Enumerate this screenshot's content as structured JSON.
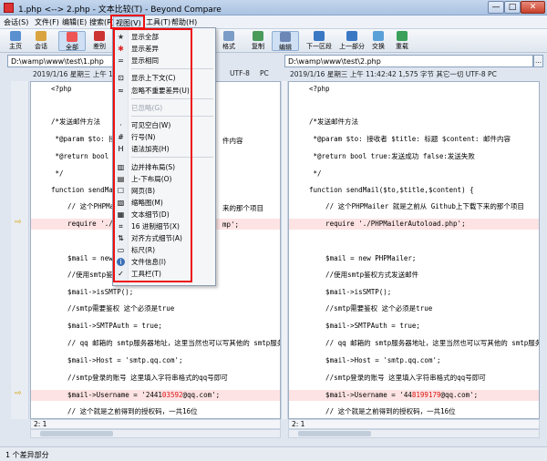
{
  "window": {
    "title": "1.php <--> 2.php - 文本比较(T) - Beyond Compare",
    "controls": [
      "—",
      "□",
      "✕"
    ]
  },
  "menubar": [
    "会话(S)",
    "文件(F)",
    "编辑(E)",
    "搜索(R)",
    "视图(V)",
    "工具(T)",
    "帮助(H)"
  ],
  "toolbar": {
    "left": [
      "主页",
      "会话",
      "全部",
      "差别"
    ],
    "right": [
      "复制",
      "编辑",
      "下一区段",
      "上一部分",
      "交换",
      "重载"
    ],
    "partial": "格式"
  },
  "paths": {
    "left": "D:\\wamp\\www\\test\\1.php",
    "right": "D:\\wamp\\www\\test\\2.php",
    "dropdown": "▾",
    "browse": "…"
  },
  "info": {
    "left": "2019/1/16 星期三 上午 11:42:5",
    "left_encoding": "UTF-8",
    "left_lineend": "PC",
    "right": "2019/1/16 星期三 上午 11:42:42   1,575 字节   其它一切   UTF-8   PC"
  },
  "view_menu": {
    "items": [
      {
        "label": "显示全部",
        "icon": "★"
      },
      {
        "label": "显示差异",
        "icon": "✱"
      },
      {
        "label": "显示相同",
        "icon": "="
      },
      {
        "label": "显示上下文(C)",
        "icon": "⊡"
      },
      {
        "label": "忽略不重要差异(U)",
        "icon": "≈"
      },
      {
        "label": "已忽略(G)",
        "icon": "",
        "disabled": true
      },
      {
        "label": "可见空白(W)",
        "icon": "·"
      },
      {
        "label": "行号(N)",
        "icon": "#"
      },
      {
        "label": "语法加亮(H)",
        "icon": "H"
      },
      {
        "label": "边并排布局(S)",
        "icon": "▥"
      },
      {
        "label": "上-下布局(O)",
        "icon": "▤"
      },
      {
        "label": "网页(B)",
        "icon": "☐"
      },
      {
        "label": "缩略图(M)",
        "icon": "▧"
      },
      {
        "label": "文本细节(D)",
        "icon": "▦"
      },
      {
        "label": "16 进制细节(X)",
        "icon": "⌗"
      },
      {
        "label": "对齐方式细节(A)",
        "icon": "⇅"
      },
      {
        "label": "标尺(R)",
        "icon": "▭"
      },
      {
        "label": "文件信息(I)",
        "icon": "i"
      },
      {
        "label": "工具栏(T)",
        "icon": "✓"
      }
    ]
  },
  "left_lines": [
    "<?php",
    "",
    "",
    "/*发送邮件方法",
    " *@param $to: 接收",
    " *@return bool tr",
    " */",
    "function sendMail(",
    "    // 这个PHPMaile",
    "    require './PHP",
    "",
    "",
    "    $mail = new PHP",
    "    //使用smtp鉴权",
    "    $mail->isSMTP();",
    "    //smtp需要鉴权 这个必须是true",
    "    $mail->SMTPAuth = true;",
    "    // qq 邮箱的 smtp服务器地址，这里当然也可以写其他的 smtp服务",
    "    $mail->Host = 'smtp.qq.com';",
    "    //smtp登录的账号 这里填入字符串格式的qq号即可",
    "    $mail->Username = '2441",
    "    // 这个就是之前得到的授权码，一共16位"
  ],
  "left_tail": {
    "partial_a": "件内容",
    "partial_b": "来的那个项目",
    "partial_c": "mp';",
    "username_hl": "03592",
    "username_end": "@qq.com';"
  },
  "right_lines": [
    "<?php",
    "",
    "",
    "/*发送邮件方法",
    " *@param $to: 接收者 $title: 标题 $content: 邮件内容",
    " *@return bool true:发送成功 false:发送失败",
    " */",
    "function sendMail($to,$title,$content) {",
    "    // 这个PHPMailer 就是之前从 Github上下载下来的那个项目",
    "    require './PHPMailerAutoload.php';",
    "",
    "",
    "    $mail = new PHPMailer;",
    "    //使用smtp鉴权方式发送邮件",
    "    $mail->isSMTP();",
    "    //smtp需要鉴权 这个必须是true",
    "    $mail->SMTPAuth = true;",
    "    // qq 邮箱的 smtp服务器地址，这里当然也可以写其他的 smtp服务器地址",
    "    $mail->Host = 'smtp.qq.com';",
    "    //smtp登录的账号 这里填入字符串格式的qq号即可",
    "    $mail->Username = '44",
    "    // 这个就是之前得到的授权码，一共16位"
  ],
  "right_tail": {
    "username_hl": "8199179",
    "username_end": "@qq.com';"
  },
  "position": {
    "left": "2: 1",
    "right": "2: 1"
  },
  "status": "1 个差异部分"
}
